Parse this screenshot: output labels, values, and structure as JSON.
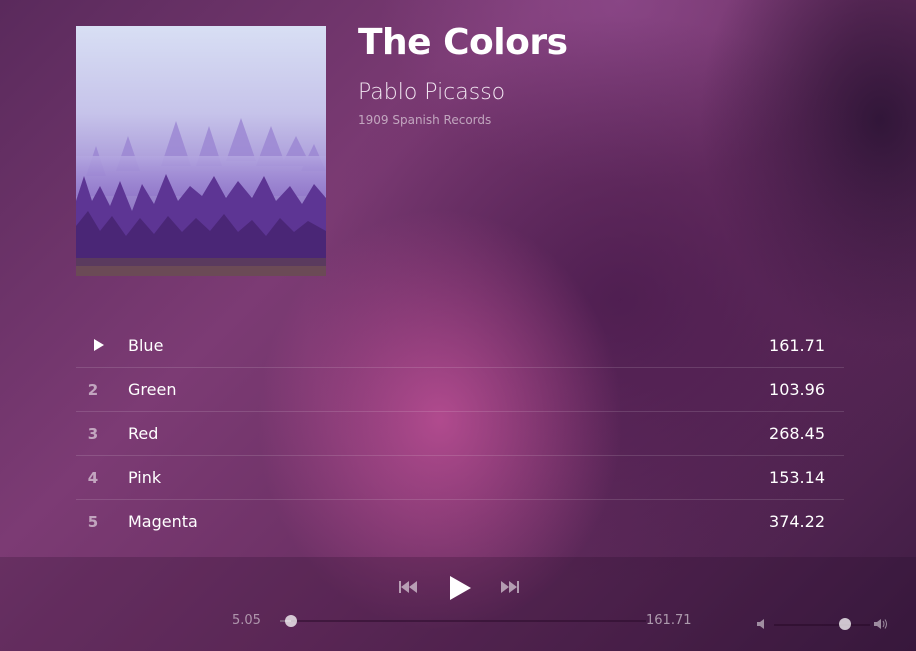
{
  "album": {
    "title": "The Colors",
    "artist": "Pablo Picasso",
    "label": "1909 Spanish Records",
    "cover_icon": "forest-cover-art"
  },
  "tracks": [
    {
      "number": "",
      "name": "Blue",
      "duration": "161.71",
      "playing": true
    },
    {
      "number": "2",
      "name": "Green",
      "duration": "103.96",
      "playing": false
    },
    {
      "number": "3",
      "name": "Red",
      "duration": "268.45",
      "playing": false
    },
    {
      "number": "4",
      "name": "Pink",
      "duration": "153.14",
      "playing": false
    },
    {
      "number": "5",
      "name": "Magenta",
      "duration": "374.22",
      "playing": false
    }
  ],
  "player": {
    "current_time": "5.05",
    "total_time": "161.71",
    "progress": 0.031,
    "volume": 0.74,
    "icons": [
      "previous-icon",
      "play-icon",
      "next-icon",
      "volume-low-icon",
      "volume-high-icon"
    ]
  }
}
